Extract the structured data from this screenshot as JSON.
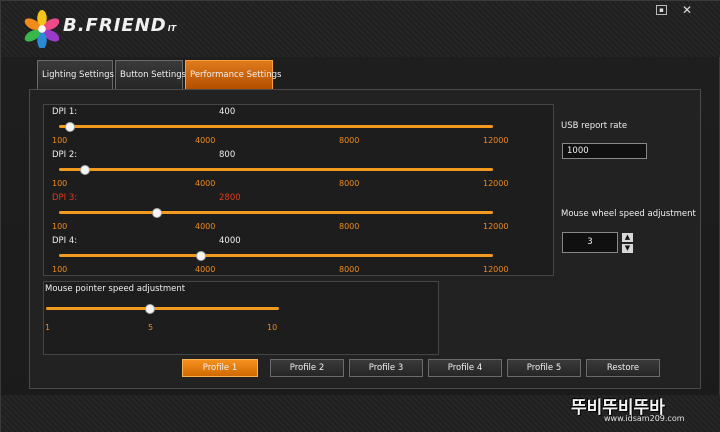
{
  "app": {
    "name": "B.FRIEND",
    "name_suffix": "IT"
  },
  "tabs": [
    {
      "label": "Lighting Settings",
      "active": false
    },
    {
      "label": "Button Settings",
      "active": false
    },
    {
      "label": "Performance Settings",
      "active": true
    }
  ],
  "dpi": [
    {
      "label": "DPI 1:",
      "value": "400",
      "highlight": false
    },
    {
      "label": "DPI 2:",
      "value": "800",
      "highlight": false
    },
    {
      "label": "DPI 3:",
      "value": "2800",
      "highlight": true
    },
    {
      "label": "DPI 4:",
      "value": "4000",
      "highlight": false
    }
  ],
  "dpi_ticks": [
    "100",
    "4000",
    "8000",
    "12000"
  ],
  "dpi_range": [
    100,
    12000
  ],
  "mouse_speed": {
    "label": "Mouse pointer speed adjustment",
    "value": 5,
    "ticks": [
      "1",
      "5",
      "10"
    ],
    "range": [
      1,
      10
    ]
  },
  "usb": {
    "label": "USB report rate",
    "value": "1000"
  },
  "wheel": {
    "label": "Mouse wheel speed adjustment",
    "value": "3"
  },
  "icons": {
    "restore": "restore-window-icon",
    "close": "close-icon",
    "spin_up": "triangle-up-icon",
    "spin_down": "triangle-down-icon"
  },
  "profiles": [
    {
      "label": "Profile 1",
      "active": true
    },
    {
      "label": "Profile 2",
      "active": false
    },
    {
      "label": "Profile 3",
      "active": false
    },
    {
      "label": "Profile 4",
      "active": false
    },
    {
      "label": "Profile 5",
      "active": false
    },
    {
      "label": "Restore",
      "active": false
    }
  ],
  "watermark": {
    "text": "뚜비뚜비뚜바",
    "sub": "www.idsam209.com"
  },
  "colors": {
    "accent": "#f29a20",
    "highlight": "#e23a1a",
    "background": "#1a1a1a"
  }
}
